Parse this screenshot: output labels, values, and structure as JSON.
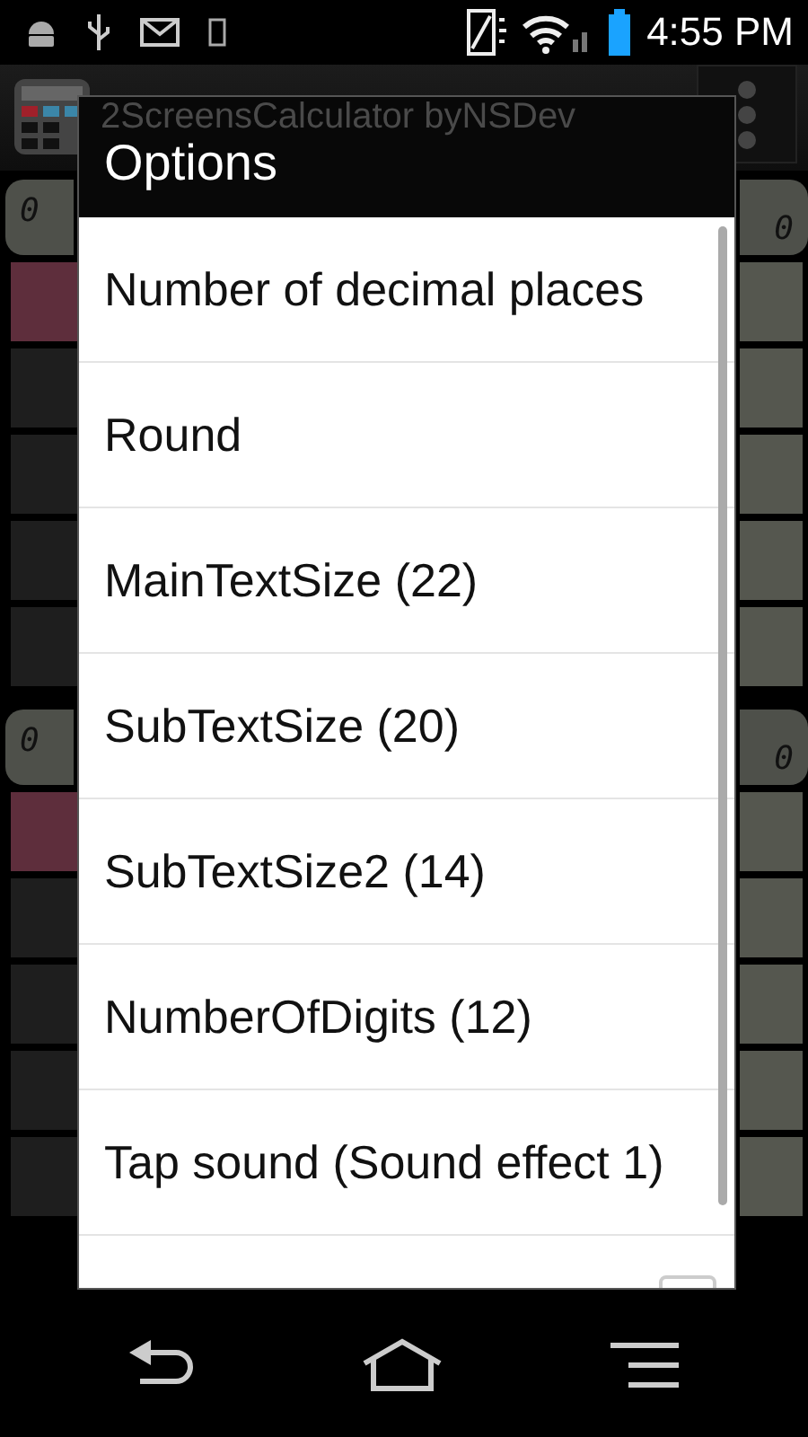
{
  "status_bar": {
    "time": "4:55 PM"
  },
  "app_bar": {
    "title": "2ScreensCalculator byNSDev"
  },
  "panels": [
    {
      "left_reading": "0",
      "right_reading": "0",
      "left_keys": [
        {
          "color": "#5e2e3c"
        },
        {
          "color": "#1e1e1e"
        },
        {
          "color": "#1e1e1e"
        },
        {
          "color": "#1e1e1e"
        },
        {
          "color": "#1e1e1e"
        }
      ],
      "right_keys": [
        {
          "color": "#55574f"
        },
        {
          "color": "#55574f"
        },
        {
          "color": "#55574f"
        },
        {
          "color": "#55574f"
        },
        {
          "color": "#55574f"
        }
      ]
    },
    {
      "left_reading": "0",
      "right_reading": "0",
      "left_keys": [
        {
          "color": "#5e2e3c"
        },
        {
          "color": "#1e1e1e"
        },
        {
          "color": "#1e1e1e"
        },
        {
          "color": "#1e1e1e"
        },
        {
          "color": "#1e1e1e"
        }
      ],
      "right_keys": [
        {
          "color": "#55574f"
        },
        {
          "color": "#55574f"
        },
        {
          "color": "#55574f"
        },
        {
          "color": "#55574f"
        },
        {
          "color": "#55574f"
        }
      ]
    }
  ],
  "dialog": {
    "title": "Options",
    "items": [
      {
        "kind": "text",
        "label": "Number of decimal places"
      },
      {
        "kind": "text",
        "label": "Round"
      },
      {
        "kind": "text",
        "label": "MainTextSize (22)"
      },
      {
        "kind": "text",
        "label": "SubTextSize (20)"
      },
      {
        "kind": "text",
        "label": "SubTextSize2 (14)"
      },
      {
        "kind": "text",
        "label": "NumberOfDigits (12)"
      },
      {
        "kind": "text",
        "label": "Tap sound (Sound effect 1)"
      },
      {
        "kind": "checkbox",
        "checked": false
      }
    ]
  }
}
